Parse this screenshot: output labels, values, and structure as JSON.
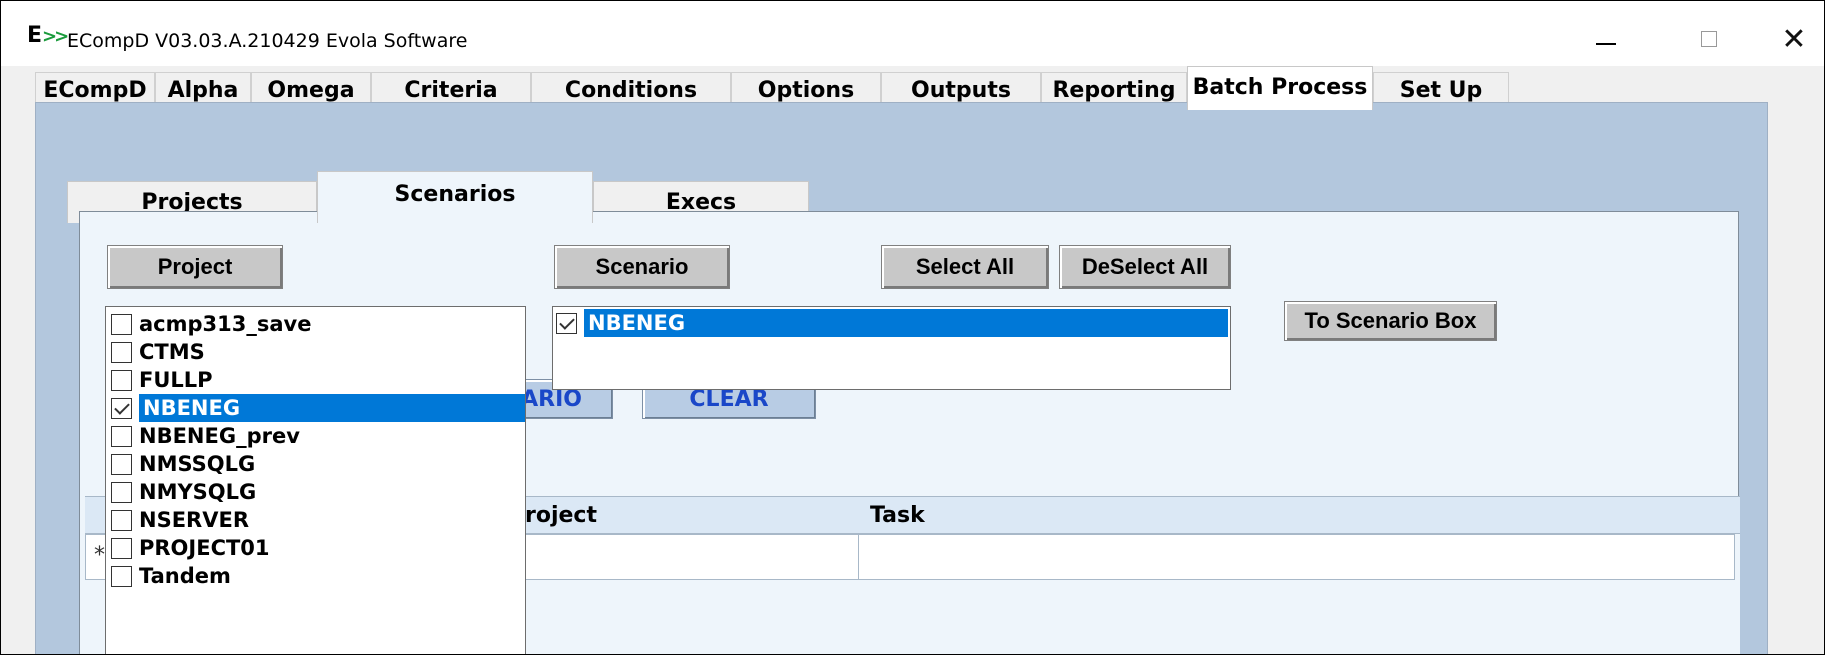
{
  "window": {
    "title": "ECompD  V03.03.A.210429  Evola Software",
    "logo_text": "E",
    "logo_arrows": ">>"
  },
  "main_tabs": [
    {
      "label": "ECompD",
      "active": false
    },
    {
      "label": "Alpha",
      "active": false
    },
    {
      "label": "Omega",
      "active": false
    },
    {
      "label": "Criteria",
      "active": false
    },
    {
      "label": "Conditions",
      "active": false
    },
    {
      "label": "Options",
      "active": false
    },
    {
      "label": "Outputs",
      "active": false
    },
    {
      "label": "Reporting",
      "active": false
    },
    {
      "label": "Batch Process",
      "active": true
    },
    {
      "label": "Set Up",
      "active": false
    }
  ],
  "sub_tabs": [
    {
      "label": "Projects",
      "active": false
    },
    {
      "label": "Scenarios",
      "active": true
    },
    {
      "label": "Execs",
      "active": false
    }
  ],
  "buttons": {
    "project": "Project",
    "scenario": "Scenario",
    "select_all": "Select All",
    "deselect_all": "DeSelect All",
    "to_scenario_box": "To Scenario Box",
    "add_scenario_partial": "ARIO",
    "clear": "CLEAR"
  },
  "grid": {
    "columns": [
      "roject",
      "Task"
    ],
    "new_row_marker": "*"
  },
  "project_list": [
    {
      "name": "acmp313_save",
      "checked": false,
      "selected": false
    },
    {
      "name": "CTMS",
      "checked": false,
      "selected": false
    },
    {
      "name": "FULLP",
      "checked": false,
      "selected": false
    },
    {
      "name": "NBENEG",
      "checked": true,
      "selected": true
    },
    {
      "name": "NBENEG_prev",
      "checked": false,
      "selected": false
    },
    {
      "name": "NMSSQLG",
      "checked": false,
      "selected": false
    },
    {
      "name": "NMYSQLG",
      "checked": false,
      "selected": false
    },
    {
      "name": "NSERVER",
      "checked": false,
      "selected": false
    },
    {
      "name": "PROJECT01",
      "checked": false,
      "selected": false
    },
    {
      "name": "Tandem",
      "checked": false,
      "selected": false
    }
  ],
  "scenario_list": [
    {
      "name": "NBENEG",
      "checked": true,
      "selected": true
    }
  ],
  "colors": {
    "selection": "#0078d7",
    "panel_blue": "#b3c7dd",
    "link_blue": "#1a47c8",
    "logo_green": "#1a9b3c"
  }
}
